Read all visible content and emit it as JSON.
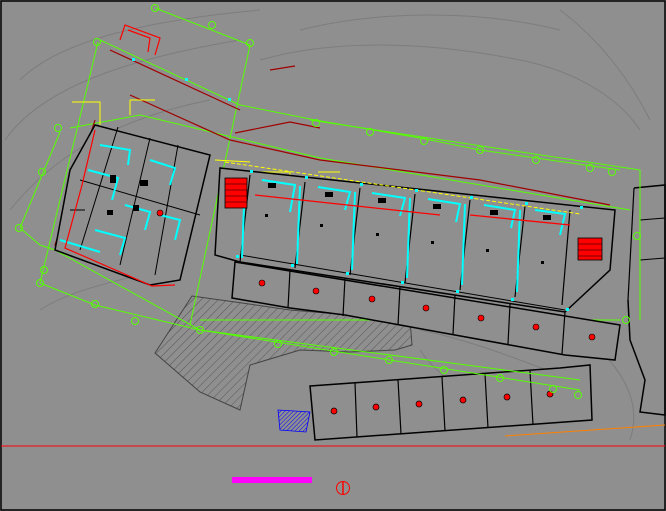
{
  "canvas": {
    "background_color": "#8f8f8f",
    "frame_color": "#000000",
    "divider_color": "#ff0000"
  },
  "colors": {
    "wall": "#000000",
    "axis_green": "#55ff00",
    "axis_red": "#b00000",
    "room_cyan": "#00ffff",
    "stair_red": "#ff0000",
    "hatch": "#444444",
    "title_magenta": "#ff00ff",
    "orange_line": "#ff8000",
    "yellow_line": "#ffff00"
  },
  "drawing": {
    "title": "",
    "north_icon": "north-arrow-icon",
    "stair_icon": "stair-icon",
    "column_marker_icon": "axis-bubble-icon",
    "room_tag_icon": "room-tag-icon"
  }
}
